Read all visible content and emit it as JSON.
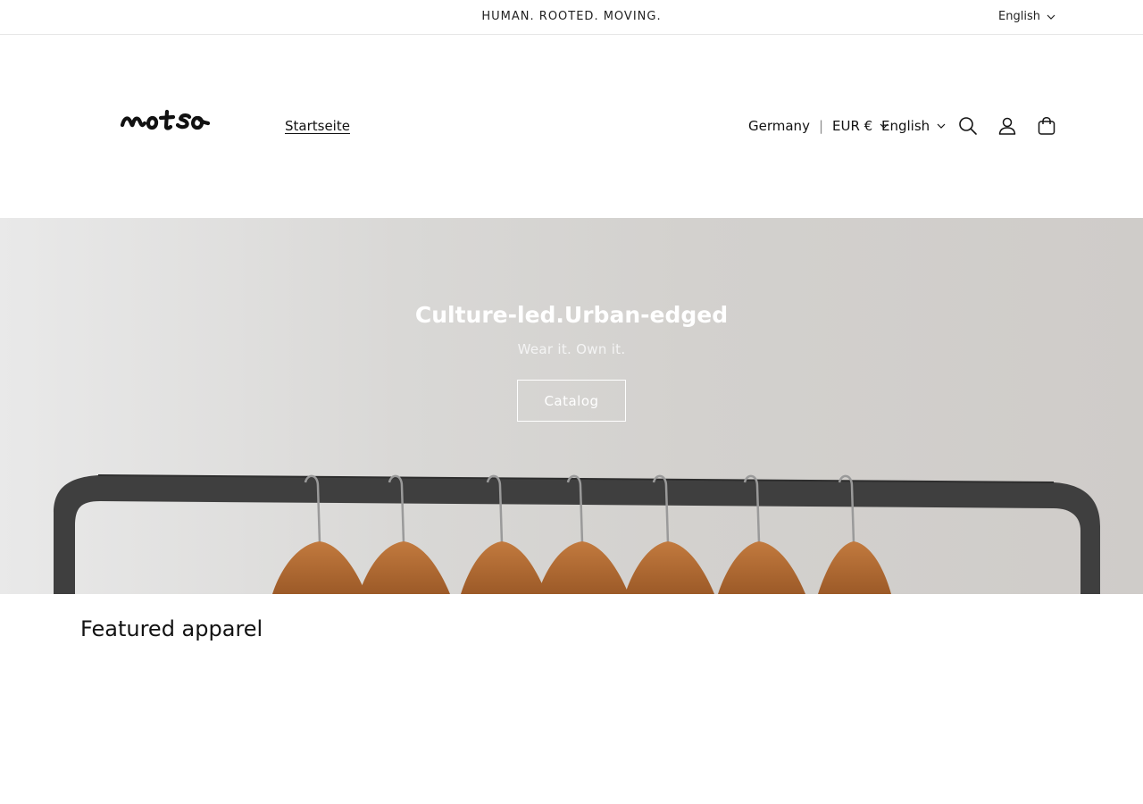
{
  "announcement": {
    "text": "HUMAN. ROOTED. MOVING.",
    "language": "English"
  },
  "header": {
    "logo_alt": "moto",
    "nav": [
      {
        "label": "Startseite"
      }
    ],
    "country": {
      "name": "Germany",
      "currency": "EUR €"
    },
    "language": "English",
    "icons": [
      "search-icon",
      "account-icon",
      "cart-icon"
    ]
  },
  "hero": {
    "title": "Culture-led.Urban-edged",
    "subtitle": "Wear it. Own it.",
    "button_label": "Catalog"
  },
  "featured": {
    "title": "Featured apparel"
  },
  "colors": {
    "text": "#121212",
    "border": "#e6e6e6",
    "hero_text": "#ffffff"
  }
}
